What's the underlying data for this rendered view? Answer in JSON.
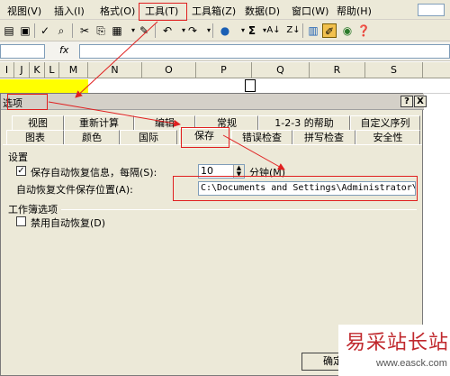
{
  "menubar": {
    "items": [
      "视图(V)",
      "插入(I)",
      "格式(O)",
      "工具(T)",
      "工具箱(Z)",
      "数据(D)",
      "窗口(W)",
      "帮助(H)"
    ]
  },
  "toolbar": {
    "sigma": "Σ",
    "fx": "fx",
    "icons": [
      "print-icon",
      "spell-check-icon",
      "research-icon",
      "cut-icon",
      "copy-icon",
      "paste-icon",
      "format-painter-icon",
      "undo-icon",
      "redo-icon",
      "hyperlink-icon",
      "autosum-icon",
      "sort-asc-icon",
      "sort-desc-icon",
      "chart-icon",
      "drawing-icon",
      "globe-icon",
      "help-icon"
    ]
  },
  "columns": [
    "I",
    "J",
    "K",
    "L",
    "M",
    "N",
    "O",
    "P",
    "Q",
    "R",
    "S"
  ],
  "dialog": {
    "title": "选项",
    "help_btn": "?",
    "close_btn": "X",
    "tabs_row1": [
      "视图",
      "重新计算",
      "编辑",
      "常规",
      "1-2-3 的帮助",
      "自定义序列"
    ],
    "tabs_row2": [
      "图表",
      "颜色",
      "国际",
      "保存",
      "错误检查",
      "拼写检查",
      "安全性"
    ],
    "settings_group": "设置",
    "autosave_label": "保存自动恢复信息，每隔(S):",
    "autosave_checked": "✓",
    "autosave_minutes": "10",
    "minutes_unit": "分钟(M)",
    "location_label": "自动恢复文件保存位置(A):",
    "location_value": "C:\\Documents and Settings\\Administrator\\Applic",
    "workbook_group": "工作簿选项",
    "disable_autorecover_label": "禁用自动恢复(D)",
    "ok_button": "确定"
  },
  "watermark": {
    "text": "易采站长站",
    "url": "www.easck.com"
  },
  "colors": {
    "annotation_red": "#e02020",
    "highlight_yellow": "#ffff00",
    "dialog_bg": "#ece9d8"
  }
}
